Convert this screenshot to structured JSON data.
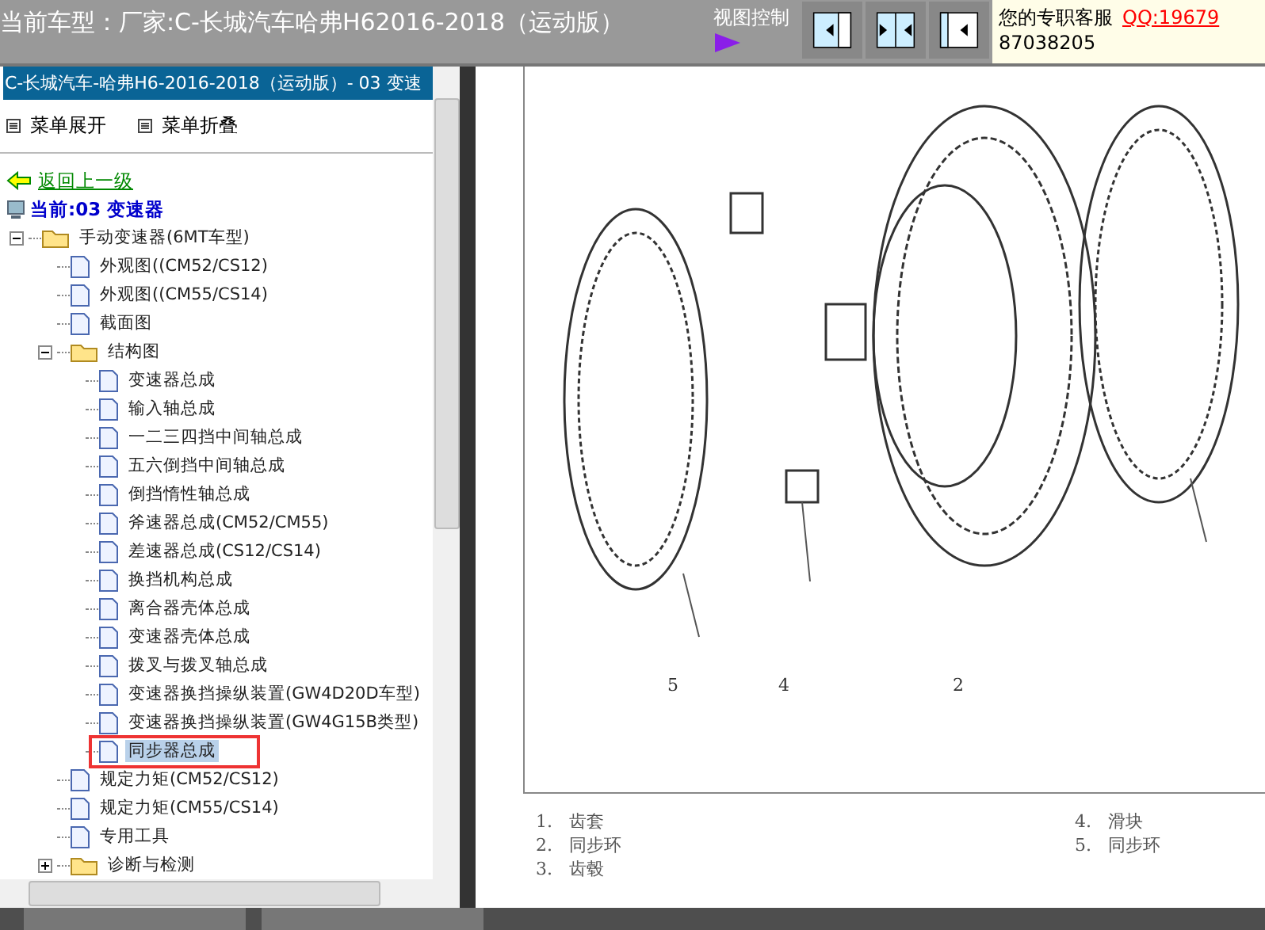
{
  "top_bar": {
    "title": "当前车型：厂家:C-长城汽车哈弗H62016-2018（运动版）",
    "view_control": {
      "label": "视图控制",
      "buttons": [
        {
          "kind": "right",
          "selected": false
        },
        {
          "kind": "both",
          "selected": false
        },
        {
          "kind": "left",
          "selected": false
        }
      ]
    },
    "service": {
      "label": "您的专职客服",
      "link": "QQ:19679",
      "number": "87038205"
    }
  },
  "sidebar": {
    "header": "C-长城汽车-哈弗H6-2016-2018（运动版）- 03 变速",
    "menu": [
      "菜单展开",
      "菜单折叠"
    ],
    "back": "返回上一级",
    "current": "当前:03 变速器",
    "tree": [
      {
        "kind": "folder",
        "label": "手动变速器(6MT车型)",
        "expanded": true,
        "selected": false,
        "children": [
          {
            "kind": "page",
            "label": "外观图((CM52/CS12)",
            "selected": false
          },
          {
            "kind": "page",
            "label": "外观图((CM55/CS14)",
            "selected": false
          },
          {
            "kind": "page",
            "label": "截面图",
            "selected": false
          },
          {
            "kind": "folder",
            "label": "结构图",
            "expanded": true,
            "selected": false,
            "children": [
              {
                "kind": "page",
                "label": "变速器总成",
                "selected": false
              },
              {
                "kind": "page",
                "label": "输入轴总成",
                "selected": false
              },
              {
                "kind": "page",
                "label": "一二三四挡中间轴总成",
                "selected": false
              },
              {
                "kind": "page",
                "label": "五六倒挡中间轴总成",
                "selected": false
              },
              {
                "kind": "page",
                "label": "倒挡惰性轴总成",
                "selected": false
              },
              {
                "kind": "page",
                "label": "斧速器总成(CM52/CM55)",
                "selected": false
              },
              {
                "kind": "page",
                "label": "差速器总成(CS12/CS14)",
                "selected": false
              },
              {
                "kind": "page",
                "label": "换挡机构总成",
                "selected": false
              },
              {
                "kind": "page",
                "label": "离合器壳体总成",
                "selected": false
              },
              {
                "kind": "page",
                "label": "变速器壳体总成",
                "selected": false
              },
              {
                "kind": "page",
                "label": "拨叉与拨叉轴总成",
                "selected": false
              },
              {
                "kind": "page",
                "label": "变速器换挡操纵装置(GW4D20D车型)",
                "selected": false
              },
              {
                "kind": "page",
                "label": "变速器换挡操纵装置(GW4G15B类型)",
                "selected": false
              },
              {
                "kind": "page",
                "label": "同步器总成",
                "selected": true
              }
            ]
          },
          {
            "kind": "page",
            "label": "规定力矩(CM52/CS12)",
            "selected": false
          },
          {
            "kind": "page",
            "label": "规定力矩(CM55/CS14)",
            "selected": false
          },
          {
            "kind": "page",
            "label": "专用工具",
            "selected": false
          },
          {
            "kind": "folder",
            "label": "诊断与检测",
            "expanded": false,
            "selected": false
          }
        ]
      }
    ]
  },
  "document": {
    "callouts": [
      "5",
      "4",
      "2"
    ],
    "legend": [
      {
        "number": "1.",
        "text": "齿套"
      },
      {
        "number": "4.",
        "text": "滑块"
      },
      {
        "number": "2.",
        "text": "同步环"
      },
      {
        "number": "5.",
        "text": "同步环"
      },
      {
        "number": "3.",
        "text": "齿毂"
      }
    ]
  }
}
